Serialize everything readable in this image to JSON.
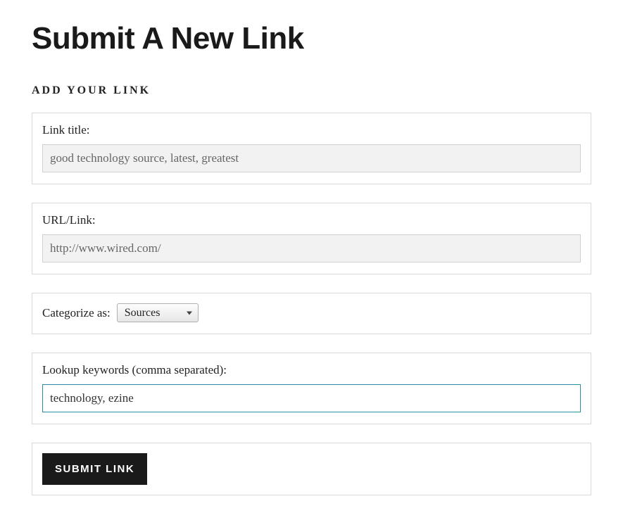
{
  "page": {
    "title": "Submit A New Link"
  },
  "section": {
    "heading": "ADD YOUR LINK"
  },
  "form": {
    "linkTitle": {
      "label": "Link title:",
      "value": "good technology source, latest, greatest"
    },
    "url": {
      "label": "URL/Link:",
      "value": "http://www.wired.com/"
    },
    "category": {
      "label": "Categorize as:",
      "selected": "Sources"
    },
    "keywords": {
      "label": "Lookup keywords (comma separated):",
      "value": "technology, ezine"
    },
    "submit": {
      "label": "SUBMIT LINK"
    }
  }
}
